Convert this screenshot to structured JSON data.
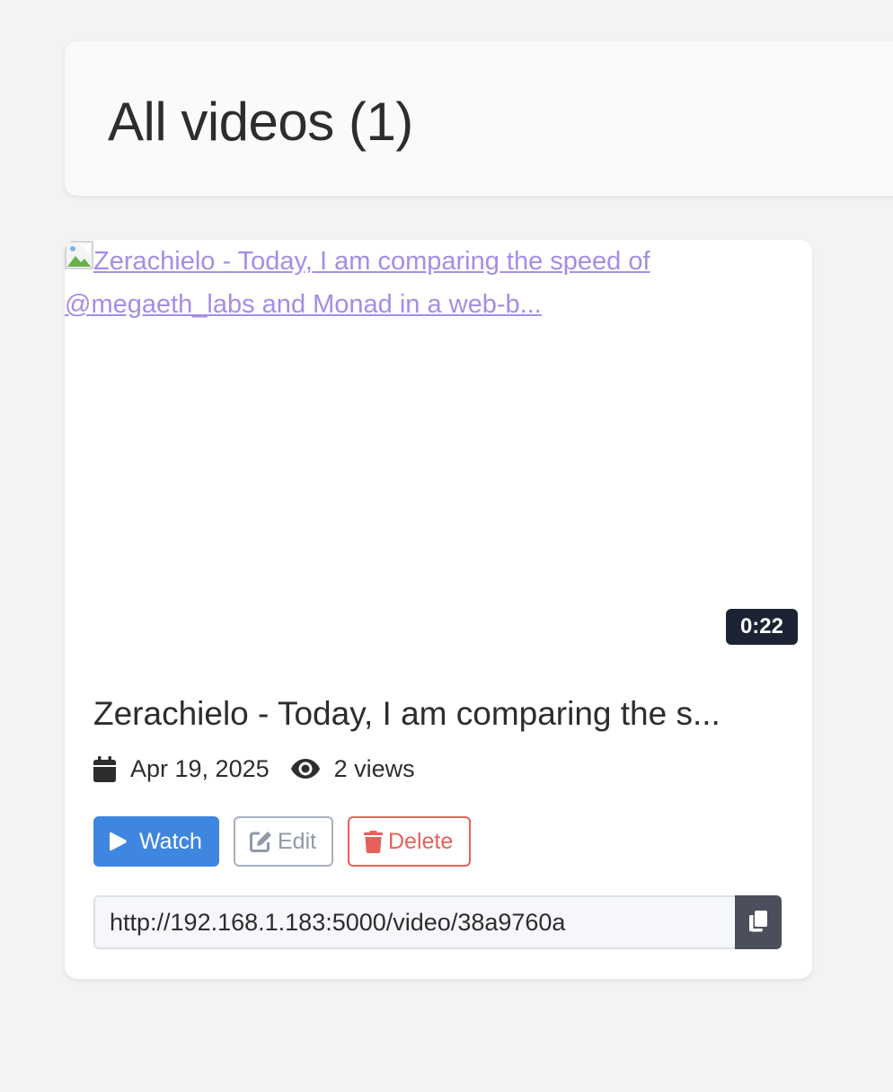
{
  "header": {
    "title": "All videos (1)"
  },
  "video": {
    "thumbnail_alt": "Zerachielo - Today, I am comparing the speed of @megaeth_labs and Monad in a web-b...",
    "duration": "0:22",
    "title": "Zerachielo - Today, I am comparing the s...",
    "date": "Apr 19, 2025",
    "views": "2 views",
    "url": "http://192.168.1.183:5000/video/38a9760a",
    "actions": {
      "watch": "Watch",
      "edit": "Edit",
      "delete": "Delete"
    }
  },
  "icons": {
    "calendar": "calendar-icon",
    "views": "eye-icon",
    "watch": "play-icon",
    "edit": "edit-icon",
    "delete": "trash-icon",
    "copy": "copy-icon",
    "broken_image": "broken-image-icon"
  },
  "colors": {
    "background": "#f3f3f3",
    "card": "#ffffff",
    "watch_button": "#3f86e0",
    "delete": "#e6615b",
    "edit": "#8f9aaa",
    "badge": "#1c2333",
    "link": "#a48ee6",
    "copy_button": "#4a4f5b"
  }
}
